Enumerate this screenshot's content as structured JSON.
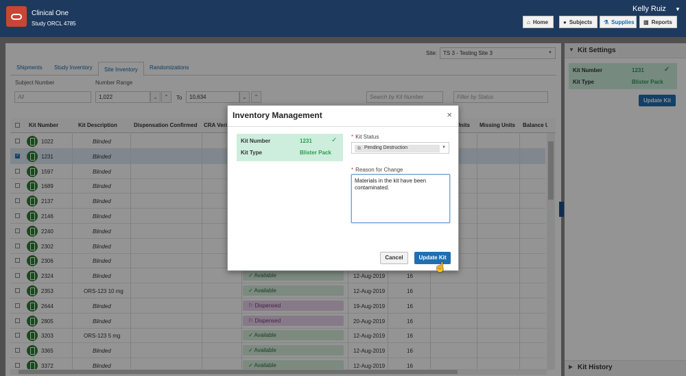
{
  "header": {
    "app_name": "Clinical One",
    "study": "Study ORCL 4785",
    "user": "Kelly Ruiz",
    "nav": [
      {
        "label": "Home",
        "icon": "home-icon"
      },
      {
        "label": "Subjects",
        "icon": "user-icon"
      },
      {
        "label": "Supplies",
        "icon": "supplies-icon",
        "active": true
      },
      {
        "label": "Reports",
        "icon": "bar-chart-icon"
      }
    ]
  },
  "site": {
    "label": "Site:",
    "value": "TS 3 - Testing Site 3"
  },
  "tabs": [
    "Shipments",
    "Study Inventory",
    "Site Inventory",
    "Randomizations"
  ],
  "filters": {
    "subject_label": "Subject Number",
    "subject_placeholder": "All",
    "range_label": "Number Range",
    "range_from": "1,022",
    "range_to_label": "To",
    "range_to": "10,634",
    "search_placeholder": "Search by Kit Number",
    "status_placeholder": "Filter by Status"
  },
  "table": {
    "columns": [
      "Kit Number",
      "Kit Description",
      "Dispensation Confirmed",
      "CRA Verified",
      "Units",
      "Missing Units",
      "Balance U"
    ],
    "rows": [
      {
        "kit": "1022",
        "desc": "Blinded",
        "status": "",
        "date": "",
        "qty": ""
      },
      {
        "kit": "1231",
        "desc": "Blinded",
        "status": "",
        "date": "",
        "qty": "",
        "selected": true
      },
      {
        "kit": "1597",
        "desc": "Blinded",
        "status": "",
        "date": "",
        "qty": ""
      },
      {
        "kit": "1689",
        "desc": "Blinded",
        "status": "",
        "date": "",
        "qty": ""
      },
      {
        "kit": "2137",
        "desc": "Blinded",
        "status": "",
        "date": "",
        "qty": ""
      },
      {
        "kit": "2146",
        "desc": "Blinded",
        "status": "",
        "date": "",
        "qty": ""
      },
      {
        "kit": "2240",
        "desc": "Blinded",
        "status": "",
        "date": "",
        "qty": ""
      },
      {
        "kit": "2302",
        "desc": "Blinded",
        "status": "",
        "date": "",
        "qty": ""
      },
      {
        "kit": "2306",
        "desc": "Blinded",
        "status": "",
        "date": "",
        "qty": ""
      },
      {
        "kit": "2324",
        "desc": "Blinded",
        "status": "Available",
        "date": "12-Aug-2019",
        "qty": "16"
      },
      {
        "kit": "2353",
        "desc": "ORS-123 10 mg",
        "status": "Available",
        "date": "12-Aug-2019",
        "qty": "16"
      },
      {
        "kit": "2644",
        "desc": "Blinded",
        "status": "Dispensed",
        "date": "19-Aug-2019",
        "qty": "16"
      },
      {
        "kit": "2805",
        "desc": "Blinded",
        "status": "Dispensed",
        "date": "20-Aug-2019",
        "qty": "16"
      },
      {
        "kit": "3203",
        "desc": "ORS-123 5 mg",
        "status": "Available",
        "date": "12-Aug-2019",
        "qty": "16"
      },
      {
        "kit": "3365",
        "desc": "Blinded",
        "status": "Available",
        "date": "12-Aug-2019",
        "qty": "16"
      },
      {
        "kit": "3372",
        "desc": "Blinded",
        "status": "Available",
        "date": "12-Aug-2019",
        "qty": "16"
      }
    ]
  },
  "kit_settings": {
    "title": "Kit Settings",
    "kit_number_label": "Kit Number",
    "kit_number": "1231",
    "kit_type_label": "Kit Type",
    "kit_type": "Blister Pack",
    "button": "Update Kit",
    "history_title": "Kit History"
  },
  "modal": {
    "title": "Inventory Management",
    "kit_number_label": "Kit Number",
    "kit_number": "1231",
    "kit_type_label": "Kit Type",
    "kit_type": "Blister Pack",
    "status_label": "Kit Status",
    "status_value": "Pending Destruction",
    "reason_label": "Reason for Change",
    "reason_value": "Materials in the kit have been contaminated.",
    "cancel": "Cancel",
    "update": "Update Kit"
  },
  "colors": {
    "header_bg": "#1d3a5e",
    "accent": "#1f6fb2",
    "oracle_red": "#c74634",
    "available": "#d6eedc",
    "dispensed": "#e8d3ea"
  }
}
